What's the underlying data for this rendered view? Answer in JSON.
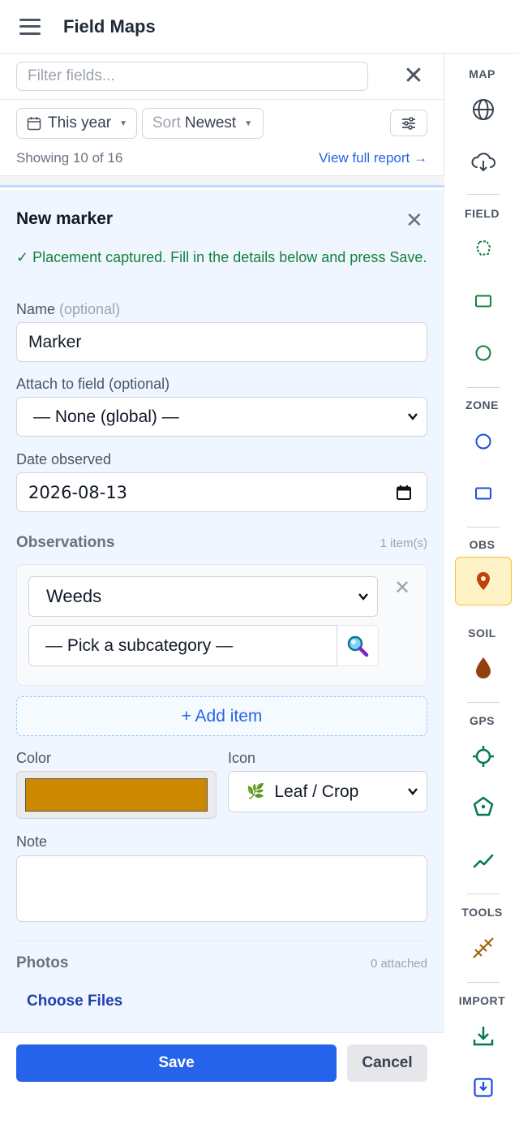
{
  "header": {
    "title": "Field Maps",
    "menu_icon": "hamburger-icon"
  },
  "filter": {
    "placeholder": "Filter fields...",
    "clear_icon": "close-icon"
  },
  "controls": {
    "year_label": "This year",
    "sort_prefix": "Sort",
    "sort_value": "Newest",
    "showing": "Showing 10 of 16",
    "report_link": "View full report →"
  },
  "form": {
    "title": "New marker",
    "message": "✓ Placement captured. Fill in the details below and press Save.",
    "name_label": "Name",
    "name_optional": "(optional)",
    "name_value": "Marker",
    "attach_label": "Attach to field (optional)",
    "attach_value": "— None (global) —",
    "date_label": "Date observed",
    "date_value": "2026-08-13",
    "observations_title": "Observations",
    "observations_count": "1 item(s)",
    "observation_category": "Weeds",
    "observation_subcategory": "— Pick a subcategory —",
    "add_item": "+ Add item",
    "color_label": "Color",
    "color_value": "#cc8800",
    "icon_label": "Icon",
    "icon_glyph": "🌿",
    "icon_value": "Leaf / Crop",
    "note_label": "Note",
    "note_value": "",
    "photos_title": "Photos",
    "photos_count": "0 attached",
    "choose_files": "Choose Files",
    "save": "Save",
    "cancel": "Cancel"
  },
  "toolbar": {
    "map_label": "MAP",
    "field_label": "FIELD",
    "zone_label": "ZONE",
    "obs_label": "OBS",
    "soil_label": "SOIL",
    "gps_label": "GPS",
    "tools_label": "TOOLS",
    "import_label": "IMPORT"
  },
  "colors": {
    "primary": "#2563eb",
    "success": "#15803d",
    "field_green": "#15803d",
    "zone_blue": "#1d4ed8",
    "obs_orange": "#c2410c",
    "soil_brown": "#92400e",
    "gps_teal": "#047857",
    "active_bg": "#fef3c7"
  }
}
